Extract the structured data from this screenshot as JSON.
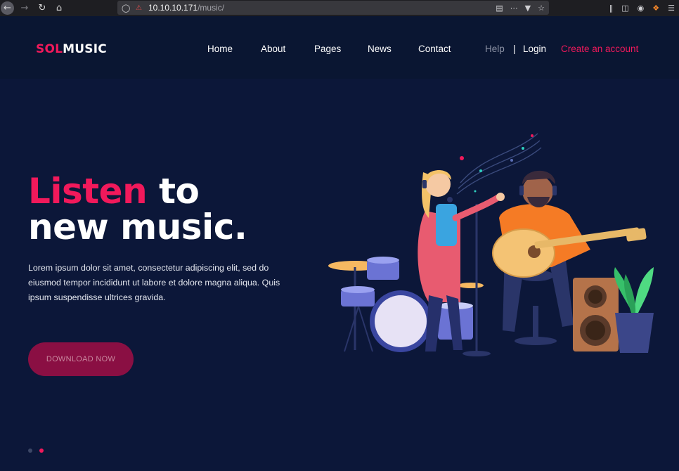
{
  "browser": {
    "url_host": "10.10.10.171",
    "url_path": "/music/",
    "icons": [
      "back-icon",
      "forward-icon",
      "reload-icon",
      "home-icon",
      "shield-icon",
      "insecure-lock-icon",
      "reader-view-icon",
      "more-icon",
      "pocket-icon",
      "bookmark-star-icon",
      "library-icon",
      "sidebar-icon",
      "account-icon",
      "extension-icon",
      "menu-icon"
    ]
  },
  "header": {
    "logo_part1": "SOL",
    "logo_part2": "MUSIC",
    "nav": [
      "Home",
      "About",
      "Pages",
      "News",
      "Contact"
    ],
    "help": "Help",
    "separator": "|",
    "login": "Login",
    "create_account": "Create an account"
  },
  "hero": {
    "title_accent": "Listen",
    "title_rest_line1": " to",
    "title_line2": "new music.",
    "description": "Lorem ipsum dolor sit amet, consectetur adipiscing elit, sed do eiusmod tempor incididunt ut labore et dolore magna aliqua. Quis ipsum suspendisse ultrices gravida.",
    "button": "DOWNLOAD NOW"
  },
  "slider": {
    "active_index": 1,
    "count": 2
  },
  "colors": {
    "background": "#0c1739",
    "accent": "#f1195b",
    "button": "#8a0f43"
  }
}
